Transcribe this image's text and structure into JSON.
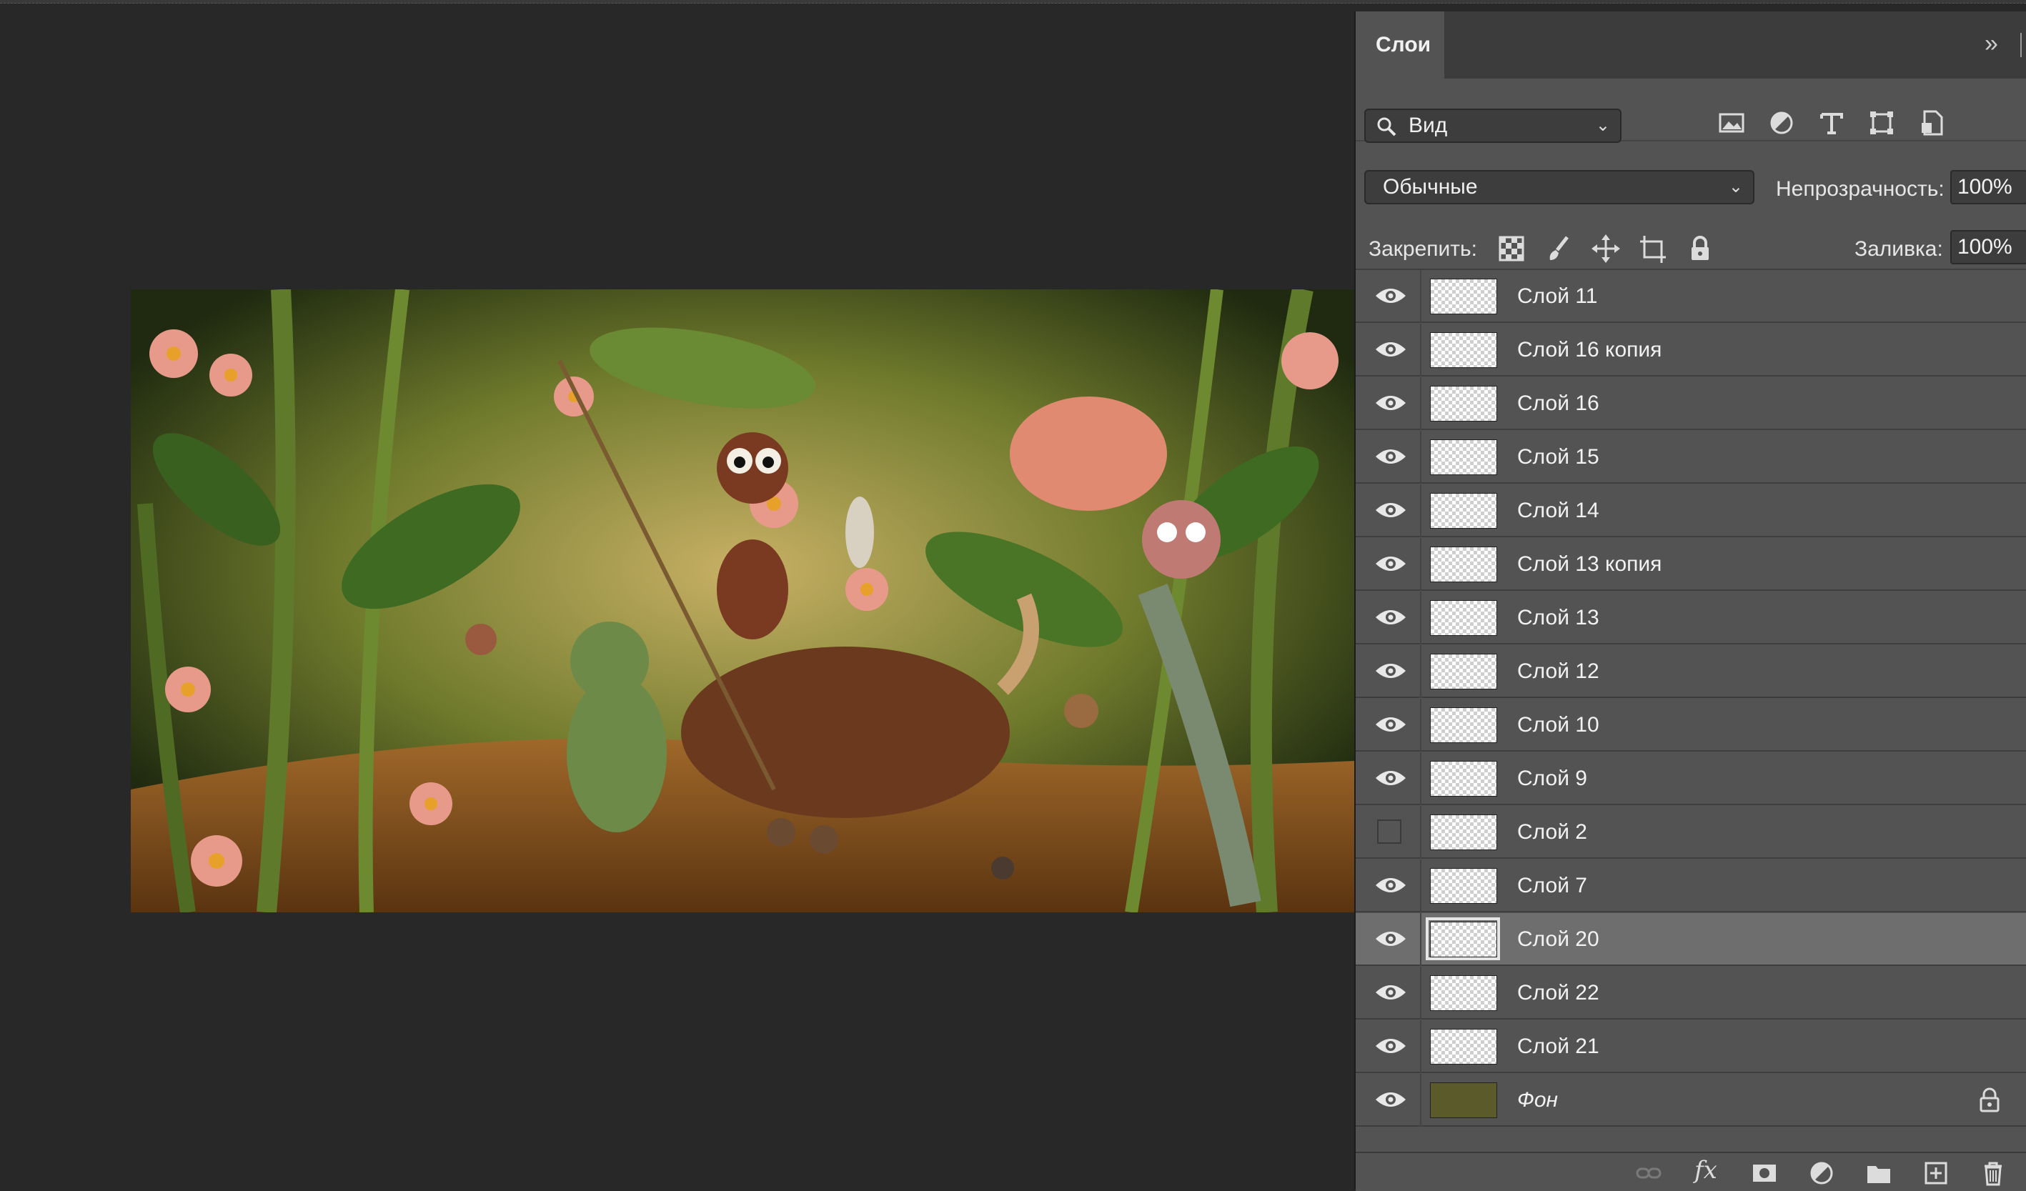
{
  "panel": {
    "tab_label": "Слои",
    "collapse_glyph": "»",
    "filter": {
      "icon": "search-icon",
      "value": "Вид"
    },
    "filter_icons": [
      "image-filter-icon",
      "adjustment-filter-icon",
      "type-filter-icon",
      "shape-filter-icon",
      "smart-object-filter-icon"
    ],
    "blend_mode": "Обычные",
    "opacity_label": "Непрозрачность:",
    "opacity_value": "100%",
    "lock_label": "Закрепить:",
    "lock_icons": [
      "lock-transparency-icon",
      "lock-pixels-icon",
      "lock-position-icon",
      "lock-artboard-icon",
      "lock-all-icon"
    ],
    "fill_label": "Заливка:",
    "fill_value": "100%"
  },
  "layers": [
    {
      "name": "Слой 11",
      "visible": true,
      "selected": false,
      "italic": false,
      "thumbnail": "transparent"
    },
    {
      "name": "Слой 16 копия",
      "visible": true,
      "selected": false,
      "italic": false,
      "thumbnail": "transparent"
    },
    {
      "name": "Слой 16",
      "visible": true,
      "selected": false,
      "italic": false,
      "thumbnail": "transparent"
    },
    {
      "name": "Слой 15",
      "visible": true,
      "selected": false,
      "italic": false,
      "thumbnail": "transparent"
    },
    {
      "name": "Слой 14",
      "visible": true,
      "selected": false,
      "italic": false,
      "thumbnail": "transparent"
    },
    {
      "name": "Слой 13 копия",
      "visible": true,
      "selected": false,
      "italic": false,
      "thumbnail": "transparent"
    },
    {
      "name": "Слой 13",
      "visible": true,
      "selected": false,
      "italic": false,
      "thumbnail": "transparent"
    },
    {
      "name": "Слой 12",
      "visible": true,
      "selected": false,
      "italic": false,
      "thumbnail": "transparent"
    },
    {
      "name": "Слой 10",
      "visible": true,
      "selected": false,
      "italic": false,
      "thumbnail": "transparent"
    },
    {
      "name": "Слой 9",
      "visible": true,
      "selected": false,
      "italic": false,
      "thumbnail": "transparent"
    },
    {
      "name": "Слой 2",
      "visible": false,
      "selected": false,
      "italic": false,
      "thumbnail": "transparent"
    },
    {
      "name": "Слой 7",
      "visible": true,
      "selected": false,
      "italic": false,
      "thumbnail": "transparent"
    },
    {
      "name": "Слой 20",
      "visible": true,
      "selected": true,
      "italic": false,
      "thumbnail": "transparent"
    },
    {
      "name": "Слой 22",
      "visible": true,
      "selected": false,
      "italic": false,
      "thumbnail": "transparent"
    },
    {
      "name": "Слой 21",
      "visible": true,
      "selected": false,
      "italic": false,
      "thumbnail": "transparent"
    },
    {
      "name": "Фон",
      "visible": true,
      "selected": false,
      "italic": true,
      "thumbnail": "photo",
      "locked": true
    }
  ],
  "bottom_icons": [
    "link-layers-icon",
    "fx-icon",
    "add-mask-icon",
    "new-adjustment-icon",
    "new-group-icon",
    "new-layer-icon",
    "delete-layer-icon"
  ],
  "bottom_fx_label": "fx",
  "colors": {
    "panel_bg": "#535353",
    "canvas_bg": "#282828",
    "selected_row": "#6e6e6e"
  }
}
